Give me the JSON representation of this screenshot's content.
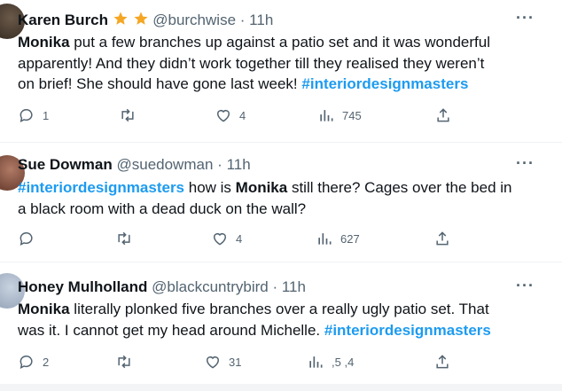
{
  "tweets": [
    {
      "name": "Karen Burch",
      "handle": "@burchwise",
      "dot": "·",
      "time": "11h",
      "badges": [
        "star-icon",
        "star-icon"
      ],
      "line1_bold": "Monika",
      "line1_rest": " put a few branches up against a patio set and it was wonderful",
      "line2": "apparently!  And they didn’t work together till they realised they weren’t",
      "line3_plain": "on brief! She should have gone last week! ",
      "hashtag": "#interiordesignmasters",
      "reply_count": "1",
      "like_count": "4",
      "view_count": "745"
    },
    {
      "name": "Sue Dowman",
      "handle": "@suedowman",
      "dot": "·",
      "time": "11h",
      "hashtag": "#interiordesignmasters",
      "line1_mid": " how is ",
      "line1_bold": "Monika",
      "line1_rest": " still there? Cages over the bed in",
      "line2": "a black room with a dead duck on the wall?",
      "reply_count": "",
      "like_count": "4",
      "view_count": "627"
    },
    {
      "name": "Honey Mulholland",
      "handle": "@blackcuntrybird",
      "dot": "·",
      "time": "11h",
      "line1_bold": "Monika",
      "line1_rest": " literally plonked five branches over a really ugly patio set. That",
      "line2_plain": "was it. I cannot get my head around Michelle. ",
      "hashtag": "#interiordesignmasters",
      "reply_count": "2",
      "like_count": "31",
      "view_count": ",5 ,4"
    }
  ],
  "more_label": "···",
  "colors": {
    "accent": "#1d9bf0",
    "muted": "#536471",
    "text": "#0f1419",
    "star": "#f5a623"
  }
}
